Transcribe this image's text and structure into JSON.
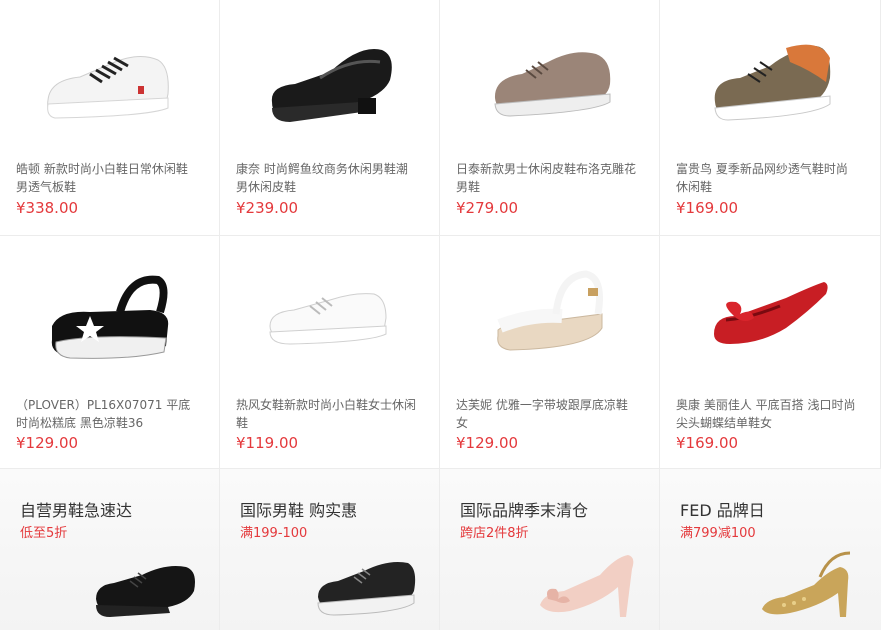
{
  "products": [
    {
      "title": "皓顿 新款时尚小白鞋日常休闲鞋男透气板鞋",
      "price": "¥338.00",
      "icon": "white-sneaker-icon"
    },
    {
      "title": "康奈 时尚鳄鱼纹商务休闲男鞋潮男休闲皮鞋",
      "price": "¥239.00",
      "icon": "black-loafer-icon"
    },
    {
      "title": "日泰新款男士休闲皮鞋布洛克雕花男鞋",
      "price": "¥279.00",
      "icon": "brogue-shoe-icon"
    },
    {
      "title": "富贵鸟 夏季新品网纱透气鞋时尚休闲鞋",
      "price": "¥169.00",
      "icon": "mesh-casual-shoe-icon"
    },
    {
      "title": "（PLOVER）PL16X07071 平底时尚松糕底 黑色凉鞋36",
      "price": "¥129.00",
      "icon": "platform-sandal-icon"
    },
    {
      "title": "热风女鞋新款时尚小白鞋女士休闲鞋",
      "price": "¥119.00",
      "icon": "white-canvas-shoe-icon"
    },
    {
      "title": "达芙妮 优雅一字带坡跟厚底凉鞋女",
      "price": "¥129.00",
      "icon": "wedge-sandal-icon"
    },
    {
      "title": "奥康 美丽佳人 平底百搭 浅口时尚尖头蝴蝶结单鞋女",
      "price": "¥169.00",
      "icon": "red-bow-flat-icon"
    }
  ],
  "promos": [
    {
      "title": "自营男鞋急速达",
      "subtitle": "低至5折",
      "icon": "black-dress-shoe-icon"
    },
    {
      "title": "国际男鞋 购实惠",
      "subtitle": "满199-100",
      "icon": "black-sneaker-icon"
    },
    {
      "title": "国际品牌季末清仓",
      "subtitle": "跨店2件8折",
      "icon": "pink-heel-icon"
    },
    {
      "title": "FED  品牌日",
      "subtitle": "满799减100",
      "icon": "gold-heel-icon"
    }
  ]
}
